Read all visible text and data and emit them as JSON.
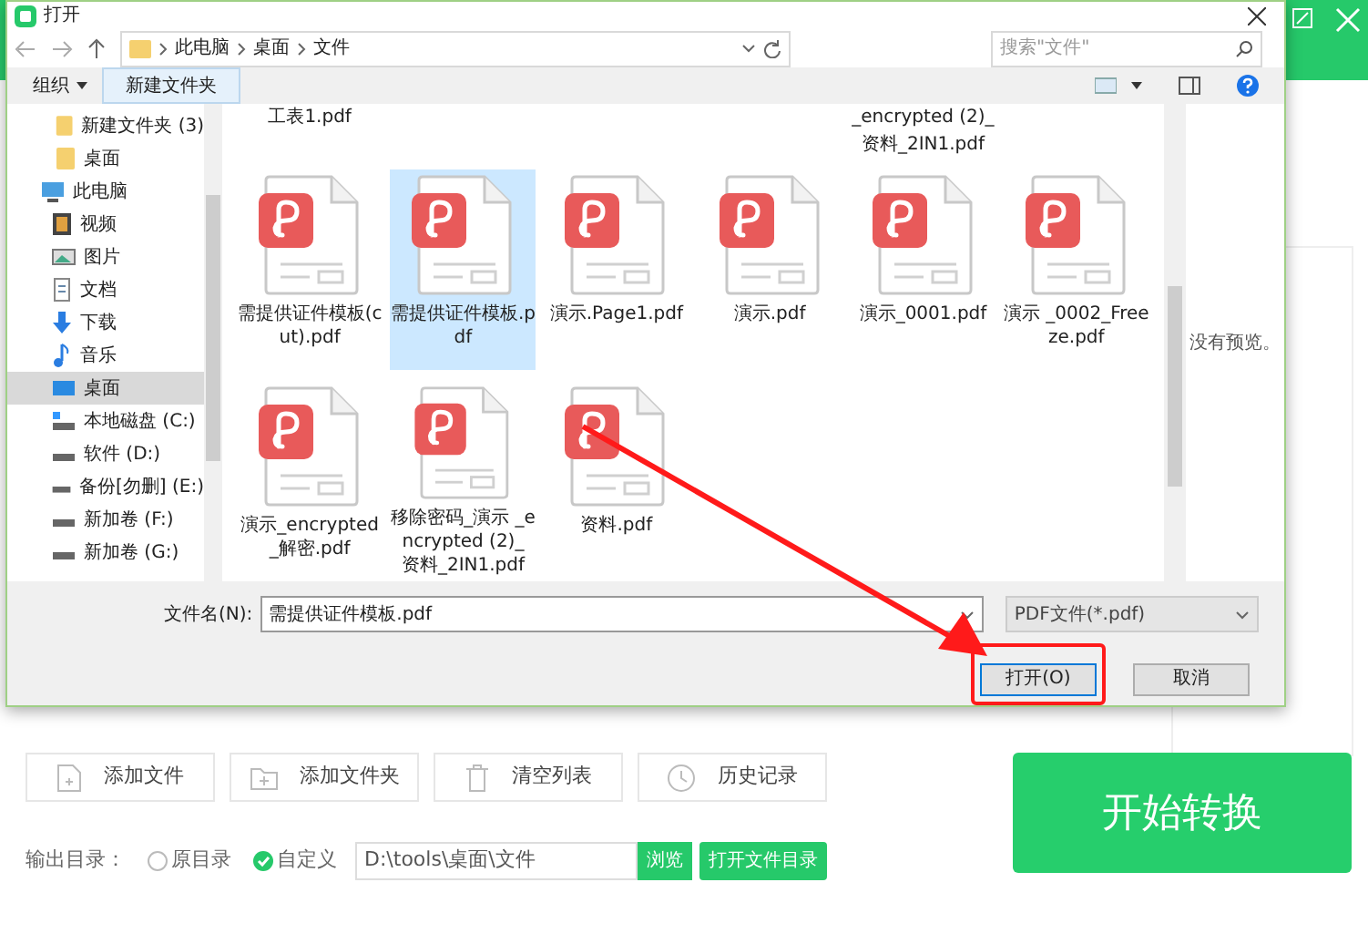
{
  "dialog": {
    "title": "打开",
    "breadcrumb": [
      "此电脑",
      "桌面",
      "文件"
    ],
    "search": {
      "placeholder": "搜索\"文件\""
    },
    "toolbar": {
      "organize": "组织",
      "new_folder": "新建文件夹"
    },
    "sidebar": [
      {
        "label": "新建文件夹 (3)",
        "kind": "folder",
        "selected": false
      },
      {
        "label": "桌面",
        "kind": "folder",
        "selected": false
      },
      {
        "label": "此电脑",
        "kind": "pc",
        "selected": false,
        "children": [
          {
            "label": "视频",
            "kind": "video",
            "selected": false
          },
          {
            "label": "图片",
            "kind": "image",
            "selected": false
          },
          {
            "label": "文档",
            "kind": "doc",
            "selected": false
          },
          {
            "label": "下载",
            "kind": "download",
            "selected": false
          },
          {
            "label": "音乐",
            "kind": "music",
            "selected": false
          },
          {
            "label": "桌面",
            "kind": "desktop",
            "selected": true
          },
          {
            "label": "本地磁盘 (C:)",
            "kind": "system-drive",
            "selected": false
          },
          {
            "label": "软件 (D:)",
            "kind": "drive",
            "selected": false
          },
          {
            "label": "备份[勿删] (E:)",
            "kind": "drive",
            "selected": false
          },
          {
            "label": "新加卷 (F:)",
            "kind": "drive",
            "selected": false
          },
          {
            "label": "新加卷 (G:)",
            "kind": "drive",
            "selected": false
          }
        ]
      }
    ],
    "top_row": [
      {
        "name": "工表1.pdf"
      },
      {
        "name": "_encrypted (2)_ 资料_2IN1.pdf"
      }
    ],
    "files": [
      {
        "name": "需提供证件模板(cut).pdf",
        "selected": false
      },
      {
        "name": "需提供证件模板.pdf",
        "selected": true
      },
      {
        "name": "演示.Page1.pdf",
        "selected": false
      },
      {
        "name": "演示.pdf",
        "selected": false
      },
      {
        "name": "演示_0001.pdf",
        "selected": false
      },
      {
        "name": "演示 _0002_Freeze.pdf",
        "selected": false
      },
      {
        "name": "演示_encrypted_解密.pdf",
        "selected": false
      },
      {
        "name": "移除密码_演示 _encrypted (2)_ 资料_2IN1.pdf",
        "selected": false
      },
      {
        "name": "资料.pdf",
        "selected": false
      }
    ],
    "preview": "没有预览。",
    "filename": {
      "label": "文件名(N):",
      "value": "需提供证件模板.pdf"
    },
    "filetype": "PDF文件(*.pdf)",
    "buttons": [
      {
        "label": "打开(O)",
        "highlighted": true
      },
      {
        "label": "取消",
        "highlighted": false
      }
    ]
  },
  "app": {
    "actions": [
      {
        "label": "添加文件",
        "kind": "file"
      },
      {
        "label": "添加文件夹",
        "kind": "folder"
      },
      {
        "label": "清空列表",
        "kind": "trash"
      },
      {
        "label": "历史记录",
        "kind": "clock"
      }
    ],
    "output": {
      "label": "输出目录：",
      "options": [
        {
          "label": "原目录",
          "selected": false
        },
        {
          "label": "自定义",
          "selected": true
        }
      ],
      "path": "D:\\tools\\桌面\\文件",
      "browse": "浏览",
      "open_dir": "打开文件目录"
    },
    "start": "开始转换"
  }
}
